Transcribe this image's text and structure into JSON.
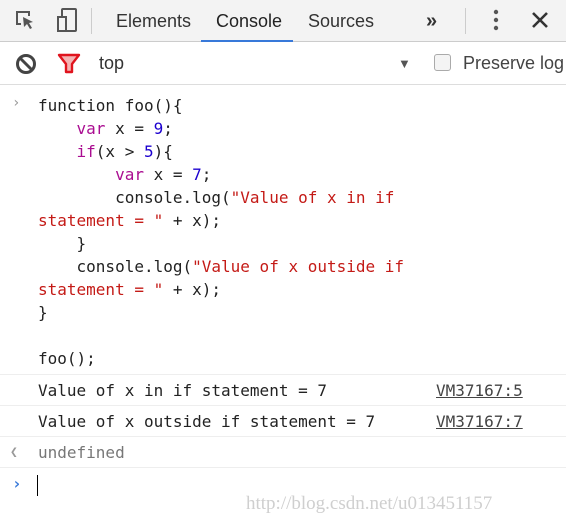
{
  "toolbar": {
    "icons": [
      "inspect-element-icon",
      "device-toolbar-icon",
      "more-tabs-icon",
      "kebab-menu-icon",
      "close-icon"
    ],
    "tabs": [
      {
        "label": "Elements",
        "active": false
      },
      {
        "label": "Console",
        "active": true
      },
      {
        "label": "Sources",
        "active": false
      }
    ],
    "more_tabs": "»",
    "accent_color": "#3879d9"
  },
  "filterbar": {
    "clear_icon": "clear-console-icon",
    "filter_icon": "filter-icon",
    "filter_color": "#e0141e",
    "context": "top",
    "context_arrow": "▼",
    "preserve_log_label": "Preserve log",
    "preserve_log_checked": false
  },
  "console": {
    "input_prompt": "›",
    "code_lines": [
      [
        {
          "t": "function foo(){",
          "c": ""
        }
      ],
      [
        {
          "t": "    ",
          "c": ""
        },
        {
          "t": "var",
          "c": "kw"
        },
        {
          "t": " x = ",
          "c": ""
        },
        {
          "t": "9",
          "c": "num"
        },
        {
          "t": ";",
          "c": ""
        }
      ],
      [
        {
          "t": "    ",
          "c": ""
        },
        {
          "t": "if",
          "c": "kw"
        },
        {
          "t": "(x > ",
          "c": ""
        },
        {
          "t": "5",
          "c": "num"
        },
        {
          "t": "){",
          "c": ""
        }
      ],
      [
        {
          "t": "        ",
          "c": ""
        },
        {
          "t": "var",
          "c": "kw"
        },
        {
          "t": " x = ",
          "c": ""
        },
        {
          "t": "7",
          "c": "num"
        },
        {
          "t": ";",
          "c": ""
        }
      ],
      [
        {
          "t": "        console.log(",
          "c": ""
        },
        {
          "t": "\"Value of x in if",
          "c": "str"
        }
      ],
      [
        {
          "t": "statement = \"",
          "c": "str"
        },
        {
          "t": " + x);",
          "c": ""
        }
      ],
      [
        {
          "t": "    }",
          "c": ""
        }
      ],
      [
        {
          "t": "    console.log(",
          "c": ""
        },
        {
          "t": "\"Value of x outside if",
          "c": "str"
        }
      ],
      [
        {
          "t": "statement = \"",
          "c": "str"
        },
        {
          "t": " + x);",
          "c": ""
        }
      ],
      [
        {
          "t": "}",
          "c": ""
        }
      ],
      [
        {
          "t": "",
          "c": ""
        }
      ],
      [
        {
          "t": "foo();",
          "c": ""
        }
      ]
    ],
    "messages": [
      {
        "text": "Value of x in if statement = 7",
        "source": "VM37167:5"
      },
      {
        "text": "Value of x outside if statement = 7",
        "source": "VM37167:7"
      }
    ],
    "result_icon": "❮",
    "result": "undefined",
    "prompt_icon": "›"
  },
  "watermark": "http://blog.csdn.net/u013451157"
}
